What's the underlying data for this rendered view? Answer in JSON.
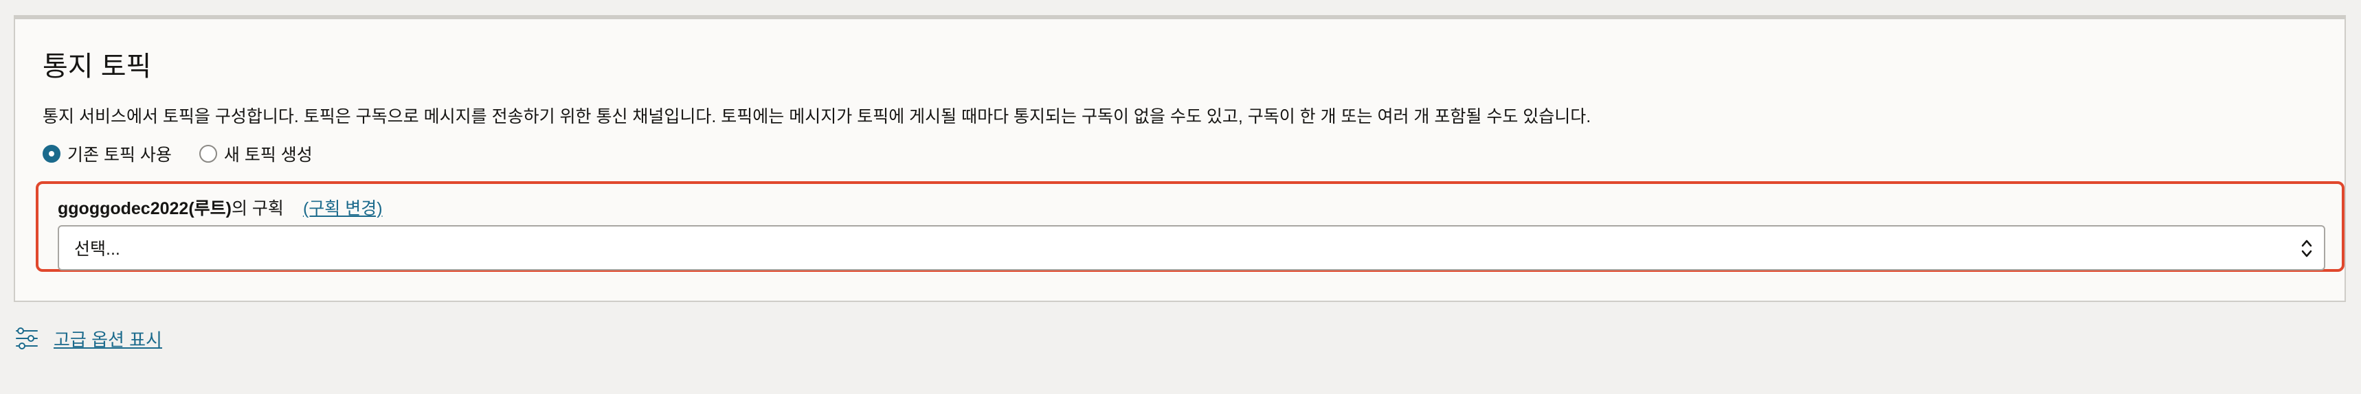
{
  "section": {
    "title": "통지 토픽",
    "description": "통지 서비스에서 토픽을 구성합니다. 토픽은 구독으로 메시지를 전송하기 위한 통신 채널입니다. 토픽에는 메시지가 토픽에 게시될 때마다 통지되는 구독이 없을 수도 있고, 구독이 한 개 또는 여러 개 포함될 수도 있습니다."
  },
  "radio_options": [
    {
      "label": "기존 토픽 사용",
      "checked": true
    },
    {
      "label": "새 토픽 생성",
      "checked": false
    }
  ],
  "compartment": {
    "name": "ggoggodec2022(루트)",
    "suffix": "의 구획",
    "change_link": "(구획 변경)"
  },
  "topic_select": {
    "value": "선택..."
  },
  "advanced": {
    "label": "고급 옵션 표시",
    "icon": "sliders-icon"
  },
  "colors": {
    "accent": "#1b6a8c",
    "highlight_border": "#e0482d"
  }
}
